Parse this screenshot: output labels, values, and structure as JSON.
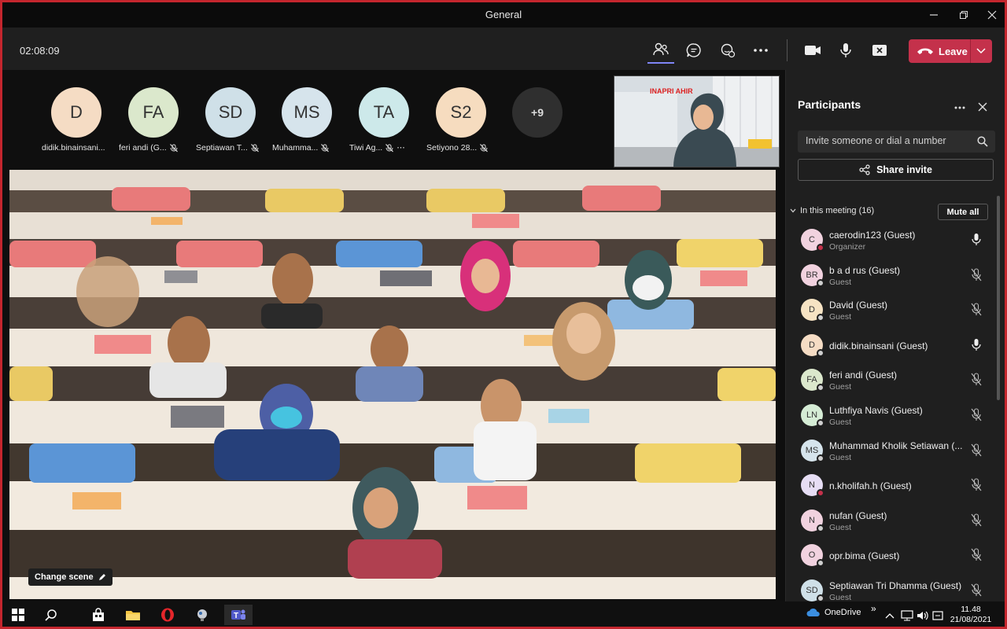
{
  "window": {
    "title": "General"
  },
  "toolbar": {
    "timer": "02:08:09",
    "leave_label": "Leave",
    "icons": [
      "participants-icon",
      "chat-icon",
      "reactions-icon",
      "more-icon",
      "camera-icon",
      "mic-icon",
      "share-screen-icon",
      "phone-icon",
      "chevron-down-icon"
    ]
  },
  "stage": {
    "avatars": [
      {
        "initials": "D",
        "name": "didik.binainsani...",
        "color": "#f5dcc4",
        "muted": false
      },
      {
        "initials": "FA",
        "name": "feri andi (G...",
        "color": "#dbe8cc",
        "muted": true
      },
      {
        "initials": "SD",
        "name": "Septiawan T...",
        "color": "#cfe0e8",
        "muted": true
      },
      {
        "initials": "MS",
        "name": "Muhamma...",
        "color": "#d6e4ec",
        "muted": true
      },
      {
        "initials": "TA",
        "name": "Tiwi Ag...",
        "color": "#cde9ea",
        "muted": true,
        "more": "⋯"
      },
      {
        "initials": "S2",
        "name": "Setiyono 28...",
        "color": "#f6dcbf",
        "muted": true
      }
    ],
    "overflow_count": "+9",
    "self_banner": "INAPRI AHIR",
    "change_scene_label": "Change scene"
  },
  "panel": {
    "title": "Participants",
    "invite_placeholder": "Invite someone or dial a number",
    "share_invite_label": "Share invite",
    "section_label": "In this meeting (16)",
    "mute_all_label": "Mute all",
    "participants": [
      {
        "initials": "C",
        "name": "caerodin123 (Guest)",
        "sub": "Organizer",
        "color": "#f1d2df",
        "status": "#c4314b",
        "muted": false
      },
      {
        "initials": "BR",
        "name": "b a d rus (Guest)",
        "sub": "Guest",
        "color": "#f1d2df",
        "status": "#cfcfcf",
        "muted": true
      },
      {
        "initials": "D",
        "name": "David (Guest)",
        "sub": "Guest",
        "color": "#f6e3c3",
        "status": "#cfcfcf",
        "muted": true
      },
      {
        "initials": "D",
        "name": "didik.binainsani (Guest)",
        "sub": "",
        "color": "#f5dcc4",
        "status": "#cfcfcf",
        "muted": false
      },
      {
        "initials": "FA",
        "name": "feri andi (Guest)",
        "sub": "Guest",
        "color": "#dbe8cc",
        "status": "#cfcfcf",
        "muted": true
      },
      {
        "initials": "LN",
        "name": "Luthfiya Navis (Guest)",
        "sub": "Guest",
        "color": "#d5ecd5",
        "status": "#cfcfcf",
        "muted": true
      },
      {
        "initials": "MS",
        "name": "Muhammad Kholik Setiawan (...",
        "sub": "Guest",
        "color": "#d6e4ec",
        "status": "#cfcfcf",
        "muted": true
      },
      {
        "initials": "N",
        "name": "n.kholifah.h (Guest)",
        "sub": "",
        "color": "#e6ddf4",
        "status": "#c4314b",
        "muted": true
      },
      {
        "initials": "N",
        "name": "nufan (Guest)",
        "sub": "Guest",
        "color": "#f1d2df",
        "status": "#cfcfcf",
        "muted": true
      },
      {
        "initials": "O",
        "name": "opr.bima (Guest)",
        "sub": "",
        "color": "#f1d2df",
        "status": "#cfcfcf",
        "muted": true
      },
      {
        "initials": "SD",
        "name": "Septiawan Tri Dhamma (Guest)",
        "sub": "Guest",
        "color": "#cfe0e8",
        "status": "#cfcfcf",
        "muted": true
      }
    ]
  },
  "taskbar": {
    "onedrive_label": "OneDrive",
    "time": "11.48",
    "date": "21/08/2021",
    "chevron": "»"
  }
}
